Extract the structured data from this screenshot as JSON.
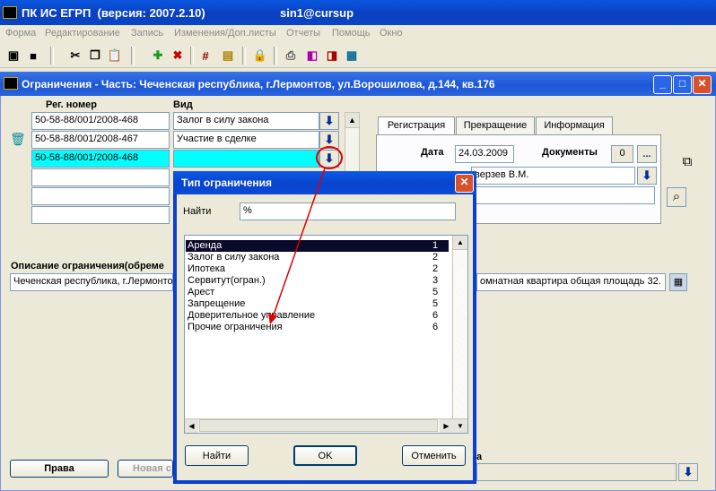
{
  "app": {
    "title": "ПК ИС ЕГРП  (версия: 2007.2.10)",
    "user": "sin1@cursup"
  },
  "menu": [
    "Форма",
    "Редактирование",
    "Запись",
    "Изменения/Доп.листы",
    "Отчеты",
    "Помощь",
    "Окно"
  ],
  "toolbar_icons": [
    "save-icon",
    "floppy-icon",
    "cut-icon",
    "copy-icon",
    "paste-icon",
    "add-icon",
    "delete-icon",
    "hash-icon",
    "document-icon",
    "lock-icon",
    "print-icon",
    "report-icon",
    "report-export-icon",
    "calculator-icon"
  ],
  "window": {
    "title": "Ограничения - Часть: Чеченская республика, г.Лермонтов, ул.Ворошилова, д.144, кв.176",
    "reg_header": "Рег. номер",
    "type_header": "Вид",
    "rows": [
      {
        "reg": "50-58-88/001/2008-468",
        "type": "Залог в силу закона"
      },
      {
        "reg": "50-58-88/001/2008-467",
        "type": "Участие в сделке"
      },
      {
        "reg": "50-58-88/001/2008-468",
        "type": ""
      },
      {
        "reg": "",
        "type": ""
      },
      {
        "reg": "",
        "type": ""
      },
      {
        "reg": "",
        "type": ""
      }
    ],
    "tabs": [
      "Регистрация",
      "Прекращение",
      "Информация"
    ],
    "date_label": "Дата",
    "date_value": "24.03.2009",
    "docs_label": "Документы",
    "docs_count": "0",
    "more_label": "...",
    "person_value": "верзев В.М.",
    "desc_label": "Описание ограничения(обреме",
    "desc_left": "Чеченская республика, г.Лермонто",
    "desc_right": "омнатная квартира   общая площадь 32.",
    "rights_button": "Права",
    "new_button": "Новая с",
    "bottom_fragment": "а"
  },
  "dialog": {
    "title": "Тип ограничения",
    "find_label": "Найти",
    "find_value": "%",
    "items": [
      {
        "name": "Аренда",
        "code": "1"
      },
      {
        "name": "Залог в силу закона",
        "code": "2"
      },
      {
        "name": "Ипотека",
        "code": "2"
      },
      {
        "name": "Сервитут(огран.)",
        "code": "3"
      },
      {
        "name": "Арест",
        "code": "5"
      },
      {
        "name": "Запрещение",
        "code": "5"
      },
      {
        "name": "Доверительное управление",
        "code": "6"
      },
      {
        "name": "Прочие ограничения",
        "code": "6"
      }
    ],
    "selected_index": 0,
    "find_button": "Найти",
    "ok_button": "OK",
    "cancel_button": "Отменить"
  },
  "annotation_color": "#e00000"
}
